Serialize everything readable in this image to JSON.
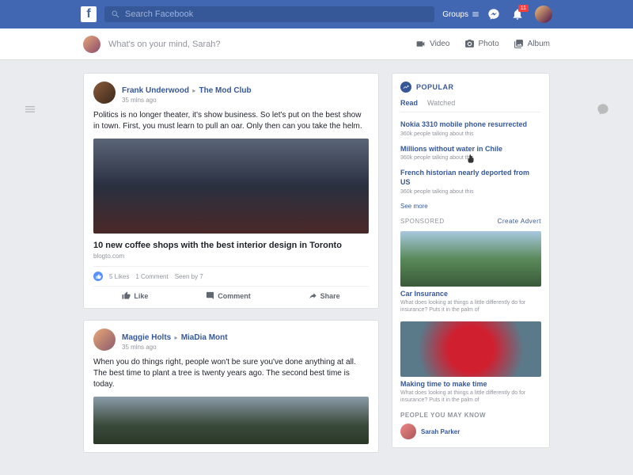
{
  "topbar": {
    "search_placeholder": "Search Facebook",
    "groups_label": "Groups",
    "notification_count": "11"
  },
  "composer": {
    "placeholder": "What's on your mind, Sarah?",
    "video_label": "Video",
    "photo_label": "Photo",
    "album_label": "Album"
  },
  "posts": [
    {
      "author": "Frank Underwood",
      "target": "The Mod Club",
      "time": "35 mins ago",
      "body": "Politics is no longer theater, it's show business. So let's put on the best show in town. First, you must learn to pull an oar. Only then can you take the helm.",
      "link_title": "10 new coffee shops with the best interior design in Toronto",
      "link_source": "blogto.com",
      "likes": "5 Likes",
      "comments": "1 Comment",
      "seen": "Seen by 7"
    },
    {
      "author": "Maggie Holts",
      "target": "MiaDia Mont",
      "time": "35 mins ago",
      "body": "When you do things right, people won't be sure you've done anything at all. The best time to plant a tree is twenty years ago. The second best time is today."
    }
  ],
  "actions": {
    "like": "Like",
    "comment": "Comment",
    "share": "Share"
  },
  "popular": {
    "title": "POPULAR",
    "tab_read": "Read",
    "tab_watched": "Watched",
    "items": [
      {
        "title": "Nokia 3310 mobile phone resurrected",
        "sub": "360k people talking about this"
      },
      {
        "title": "Millions without water in Chile",
        "sub": "360k people talking about this"
      },
      {
        "title": "French historian nearly deported from US",
        "sub": "360k people talking about this"
      }
    ],
    "see_more": "See more"
  },
  "sponsored": {
    "title": "SPONSORED",
    "create": "Create Advert",
    "ads": [
      {
        "title": "Car Insurance",
        "text": "What does looking at things a little differently do for insurance? Puts it in the palm of"
      },
      {
        "title": "Making time to make time",
        "text": "What does looking at things a little differently do for insurance? Puts it in the palm of"
      }
    ]
  },
  "people": {
    "title": "PEOPLE YOU MAY KNOW",
    "name": "Sarah Parker"
  }
}
